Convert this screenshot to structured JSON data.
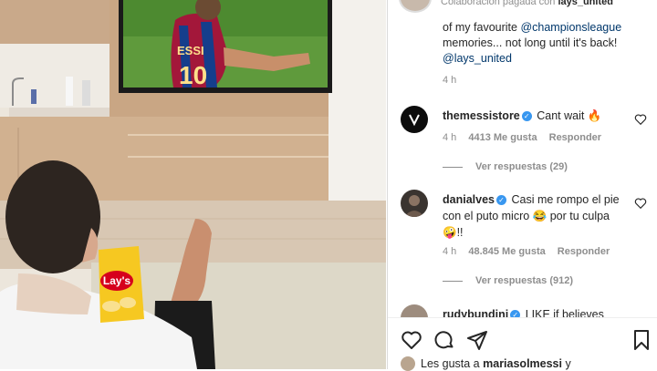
{
  "post": {
    "sponsored_prefix": "Colaboración pagada con",
    "sponsor": "lays_united"
  },
  "caption": {
    "line1_prefix": "of my favourite",
    "mention1": "@championsleague",
    "line2": "memories... not long until it's back!",
    "mention2": "@lays_united",
    "time": "4 h"
  },
  "comments": [
    {
      "user": "themessistore",
      "text": "Cant wait 🔥",
      "time": "4 h",
      "likes": "4413 Me gusta",
      "reply": "Responder",
      "replies": ""
    },
    {
      "user": "danialves",
      "text": "Casi me rompo el pie con el puto micro 😂 por tu culpa 🤪!!",
      "time": "4 h",
      "likes": "48.845 Me gusta",
      "reply": "Responder",
      "replies": "Ver respuestas (912)"
    },
    {
      "user": "rudybundini",
      "text": "LIKE if believes",
      "time": "",
      "likes": "",
      "reply": "",
      "replies": ""
    }
  ],
  "first_replies": "Ver respuestas (29)",
  "likes_bar": {
    "prefix": "Les gusta a",
    "user": "mariasolmessi",
    "suffix": "y"
  },
  "photo": {
    "bag_label": "Lay's",
    "jersey_text": "ESSI",
    "jersey_number": "10"
  },
  "icons": [
    "heart-icon",
    "comment-icon",
    "share-icon",
    "bookmark-icon",
    "verified-icon"
  ],
  "colors": {
    "link": "#00376b",
    "verified": "#3897f0",
    "muted": "#8e8e8e"
  }
}
